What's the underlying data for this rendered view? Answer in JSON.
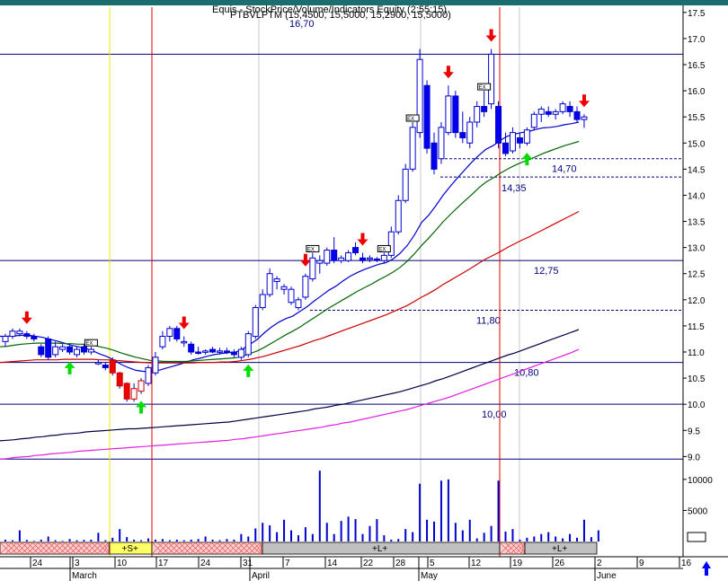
{
  "header": {
    "title_line1": "Equis - StockPrice/Volume/Indicators Equity (2:55:15)",
    "title_line2": "PTBVLPTM (15,4500, 15,5000, 15,2900, 15,5000)",
    "top_level_label": "16,70"
  },
  "colors": {
    "background": "#ffffff",
    "up_candle": "#ffffff",
    "down_candle": "#0000ee",
    "candle_outline": "#0000cc",
    "ma_short": "#0000cc",
    "ma_mid": "#006600",
    "ma_long": "#cc0000",
    "ma_200": "#000044",
    "ma_magenta": "#e020e0",
    "hline": "#00007a",
    "vline_red": "#dd0000",
    "vline_yellow": "#e8e800",
    "sell_arrow": "#ee0000",
    "buy_arrow": "#00dd00",
    "volume": "#0000cc",
    "band_pink": "#ffd0d0",
    "band_yellow": "#ffff66",
    "band_gray": "#c0c0c0",
    "corner_arrow": "#0000ff"
  },
  "chart_data": {
    "type": "candlestick",
    "title": "",
    "price_axis": {
      "ylim": [
        8.8,
        17.6
      ],
      "ticks": [
        "17.5",
        "17.0",
        "16.5",
        "16.0",
        "15.5",
        "15.0",
        "14.5",
        "14.0",
        "13.5",
        "13.0",
        "12.5",
        "12.0",
        "11.5",
        "11.0",
        "10.5",
        "10.0",
        "9.5",
        "9.0"
      ]
    },
    "volume_axis": {
      "ylim": [
        0,
        12000
      ],
      "ticks": [
        "10000",
        "5000"
      ]
    },
    "x_axis": {
      "day_ticks": [
        "24",
        "3",
        "10",
        "17",
        "24",
        "31",
        "7",
        "14",
        "22",
        "28",
        "5",
        "12",
        "19",
        "26",
        "2",
        "9",
        "16"
      ],
      "month_labels": [
        "March",
        "April",
        "May",
        "June"
      ]
    },
    "horizontal_levels": [
      {
        "value": 16.7,
        "label": "16,70",
        "style": "solid"
      },
      {
        "value": 14.7,
        "label": "14,70",
        "style": "dashed"
      },
      {
        "value": 14.35,
        "label": "14,35",
        "style": "dashed"
      },
      {
        "value": 12.75,
        "label": "12,75",
        "style": "solid"
      },
      {
        "value": 11.8,
        "label": "11,80",
        "style": "dashed"
      },
      {
        "value": 10.8,
        "label": "10,80",
        "style": "solid"
      },
      {
        "value": 10.0,
        "label": "10,00",
        "style": "solid"
      },
      {
        "value": 8.95,
        "label": "",
        "style": "solid"
      }
    ],
    "signal_bands": [
      {
        "label": "",
        "kind": "pink"
      },
      {
        "label": "+S+",
        "kind": "yellow"
      },
      {
        "label": "",
        "kind": "pink"
      },
      {
        "label": "+L+",
        "kind": "gray"
      },
      {
        "label": "",
        "kind": "pink"
      },
      {
        "label": "+L+",
        "kind": "gray"
      }
    ],
    "candles": [
      {
        "o": 11.2,
        "h": 11.35,
        "l": 11.1,
        "c": 11.3
      },
      {
        "o": 11.3,
        "h": 11.45,
        "l": 11.25,
        "c": 11.4
      },
      {
        "o": 11.35,
        "h": 11.45,
        "l": 11.3,
        "c": 11.4
      },
      {
        "o": 11.35,
        "h": 11.4,
        "l": 11.25,
        "c": 11.3
      },
      {
        "o": 11.3,
        "h": 11.35,
        "l": 11.2,
        "c": 11.25
      },
      {
        "o": 11.1,
        "h": 11.15,
        "l": 10.9,
        "c": 10.95
      },
      {
        "o": 11.25,
        "h": 11.3,
        "l": 10.85,
        "c": 10.9
      },
      {
        "o": 10.95,
        "h": 11.2,
        "l": 10.9,
        "c": 11.1
      },
      {
        "o": 11.05,
        "h": 11.15,
        "l": 11.0,
        "c": 11.1
      },
      {
        "o": 11.1,
        "h": 11.15,
        "l": 10.95,
        "c": 11.0
      },
      {
        "o": 10.95,
        "h": 11.1,
        "l": 10.9,
        "c": 11.05
      },
      {
        "o": 11.1,
        "h": 11.15,
        "l": 10.95,
        "c": 11.0
      },
      {
        "o": 11.0,
        "h": 11.1,
        "l": 10.95,
        "c": 11.05
      },
      {
        "o": 10.8,
        "h": 10.85,
        "l": 10.75,
        "c": 10.8
      },
      {
        "o": 10.75,
        "h": 10.8,
        "l": 10.65,
        "c": 10.7
      },
      {
        "o": 10.85,
        "h": 10.9,
        "l": 10.55,
        "c": 10.6
      },
      {
        "o": 10.6,
        "h": 10.62,
        "l": 10.3,
        "c": 10.35
      },
      {
        "o": 10.4,
        "h": 10.42,
        "l": 10.05,
        "c": 10.1
      },
      {
        "o": 10.1,
        "h": 10.4,
        "l": 10.05,
        "c": 10.3
      },
      {
        "o": 10.25,
        "h": 10.5,
        "l": 10.2,
        "c": 10.45
      },
      {
        "o": 10.4,
        "h": 10.75,
        "l": 10.35,
        "c": 10.7
      },
      {
        "o": 10.6,
        "h": 11.0,
        "l": 10.55,
        "c": 10.9
      },
      {
        "o": 11.1,
        "h": 11.4,
        "l": 11.05,
        "c": 11.3
      },
      {
        "o": 11.3,
        "h": 11.5,
        "l": 11.2,
        "c": 11.45
      },
      {
        "o": 11.45,
        "h": 11.5,
        "l": 11.2,
        "c": 11.25
      },
      {
        "o": 11.2,
        "h": 11.3,
        "l": 11.1,
        "c": 11.2
      },
      {
        "o": 11.15,
        "h": 11.2,
        "l": 10.95,
        "c": 11.0
      },
      {
        "o": 11.0,
        "h": 11.1,
        "l": 10.95,
        "c": 10.98
      },
      {
        "o": 11.0,
        "h": 11.05,
        "l": 10.95,
        "c": 11.02
      },
      {
        "o": 11.05,
        "h": 11.1,
        "l": 10.98,
        "c": 11.0
      },
      {
        "o": 11.0,
        "h": 11.08,
        "l": 10.95,
        "c": 11.02
      },
      {
        "o": 11.02,
        "h": 11.08,
        "l": 10.96,
        "c": 10.99
      },
      {
        "o": 11.0,
        "h": 11.05,
        "l": 10.9,
        "c": 10.95
      },
      {
        "o": 10.9,
        "h": 11.1,
        "l": 10.85,
        "c": 11.05
      },
      {
        "o": 10.95,
        "h": 11.4,
        "l": 10.9,
        "c": 11.35
      },
      {
        "o": 11.3,
        "h": 11.9,
        "l": 11.25,
        "c": 11.85
      },
      {
        "o": 11.85,
        "h": 12.2,
        "l": 11.8,
        "c": 12.1
      },
      {
        "o": 12.1,
        "h": 12.6,
        "l": 12.05,
        "c": 12.5
      },
      {
        "o": 12.35,
        "h": 12.45,
        "l": 12.2,
        "c": 12.4
      },
      {
        "o": 12.2,
        "h": 12.3,
        "l": 12.1,
        "c": 12.25
      },
      {
        "o": 11.95,
        "h": 12.25,
        "l": 11.9,
        "c": 12.2
      },
      {
        "o": 11.85,
        "h": 12.05,
        "l": 11.8,
        "c": 12.0
      },
      {
        "o": 12.05,
        "h": 12.5,
        "l": 12.0,
        "c": 12.45
      },
      {
        "o": 12.4,
        "h": 12.9,
        "l": 12.35,
        "c": 12.8
      },
      {
        "o": 12.7,
        "h": 12.85,
        "l": 12.5,
        "c": 12.75
      },
      {
        "o": 12.7,
        "h": 13.0,
        "l": 12.65,
        "c": 12.95
      },
      {
        "o": 12.95,
        "h": 13.2,
        "l": 12.7,
        "c": 12.75
      },
      {
        "o": 12.75,
        "h": 12.85,
        "l": 12.7,
        "c": 12.8
      },
      {
        "o": 12.75,
        "h": 12.95,
        "l": 12.72,
        "c": 12.9
      },
      {
        "o": 13.0,
        "h": 13.1,
        "l": 12.85,
        "c": 12.9
      },
      {
        "o": 12.8,
        "h": 12.9,
        "l": 12.7,
        "c": 12.75
      },
      {
        "o": 12.78,
        "h": 12.85,
        "l": 12.72,
        "c": 12.8
      },
      {
        "o": 12.78,
        "h": 12.82,
        "l": 12.72,
        "c": 12.76
      },
      {
        "o": 12.75,
        "h": 12.9,
        "l": 12.7,
        "c": 12.85
      },
      {
        "o": 12.85,
        "h": 13.4,
        "l": 12.8,
        "c": 13.3
      },
      {
        "o": 13.3,
        "h": 14.0,
        "l": 13.25,
        "c": 13.9
      },
      {
        "o": 13.9,
        "h": 14.6,
        "l": 13.85,
        "c": 14.5
      },
      {
        "o": 14.5,
        "h": 15.4,
        "l": 14.45,
        "c": 15.3
      },
      {
        "o": 15.2,
        "h": 16.8,
        "l": 15.1,
        "c": 16.6
      },
      {
        "o": 16.1,
        "h": 16.2,
        "l": 14.8,
        "c": 14.9
      },
      {
        "o": 15.0,
        "h": 15.2,
        "l": 14.4,
        "c": 14.5
      },
      {
        "o": 14.7,
        "h": 15.4,
        "l": 14.6,
        "c": 15.3
      },
      {
        "o": 15.2,
        "h": 16.1,
        "l": 15.15,
        "c": 15.9
      },
      {
        "o": 15.9,
        "h": 16.0,
        "l": 15.1,
        "c": 15.2
      },
      {
        "o": 15.2,
        "h": 15.6,
        "l": 15.0,
        "c": 15.1
      },
      {
        "o": 15.0,
        "h": 15.5,
        "l": 14.9,
        "c": 15.4
      },
      {
        "o": 15.4,
        "h": 15.8,
        "l": 15.3,
        "c": 15.7
      },
      {
        "o": 15.7,
        "h": 16.0,
        "l": 15.5,
        "c": 15.6
      },
      {
        "o": 15.75,
        "h": 16.8,
        "l": 15.65,
        "c": 16.7
      },
      {
        "o": 15.7,
        "h": 15.8,
        "l": 14.9,
        "c": 15.0
      },
      {
        "o": 15.0,
        "h": 15.2,
        "l": 14.75,
        "c": 14.8
      },
      {
        "o": 14.85,
        "h": 15.3,
        "l": 14.8,
        "c": 15.2
      },
      {
        "o": 15.1,
        "h": 15.2,
        "l": 14.9,
        "c": 15.0
      },
      {
        "o": 15.0,
        "h": 15.3,
        "l": 14.95,
        "c": 15.25
      },
      {
        "o": 15.3,
        "h": 15.6,
        "l": 15.25,
        "c": 15.55
      },
      {
        "o": 15.55,
        "h": 15.7,
        "l": 15.4,
        "c": 15.65
      },
      {
        "o": 15.6,
        "h": 15.7,
        "l": 15.5,
        "c": 15.55
      },
      {
        "o": 15.55,
        "h": 15.65,
        "l": 15.45,
        "c": 15.6
      },
      {
        "o": 15.6,
        "h": 15.8,
        "l": 15.55,
        "c": 15.75
      },
      {
        "o": 15.7,
        "h": 15.8,
        "l": 15.5,
        "c": 15.6
      },
      {
        "o": 15.6,
        "h": 15.7,
        "l": 15.4,
        "c": 15.45
      },
      {
        "o": 15.45,
        "h": 15.55,
        "l": 15.29,
        "c": 15.5
      }
    ],
    "volume": [
      300,
      200,
      1800,
      250,
      100,
      300,
      800,
      200,
      100,
      400,
      200,
      250,
      300,
      1400,
      200,
      600,
      2000,
      700,
      300,
      200,
      500,
      300,
      400,
      200,
      300,
      200,
      300,
      400,
      800,
      300,
      200,
      400,
      300,
      1200,
      800,
      2100,
      3000,
      2600,
      1500,
      3500,
      1800,
      1000,
      2300,
      1200,
      11400,
      3000,
      1200,
      3300,
      4000,
      3600,
      1200,
      2500,
      3600,
      1000,
      300,
      400,
      2000,
      1500,
      9300,
      3500,
      3200,
      9800,
      10000,
      3000,
      1800,
      3500,
      500,
      1400,
      2500,
      9800,
      1600,
      2000,
      300,
      600,
      800,
      1200,
      1500,
      800,
      500,
      1200,
      600,
      3500,
      700,
      1800
    ],
    "moving_averages": [
      {
        "values": [
          11.3,
          11.3,
          11.31,
          11.32,
          11.32,
          11.3,
          11.28,
          11.24,
          11.21,
          11.17,
          11.13,
          11.1,
          11.07,
          11.02,
          10.96,
          10.91,
          10.84,
          10.76,
          10.7,
          10.65,
          10.63,
          10.62,
          10.64,
          10.68,
          10.72,
          10.76,
          10.8,
          10.85,
          10.88,
          10.92,
          10.95,
          10.97,
          10.99,
          11.0,
          11.06,
          11.15,
          11.24,
          11.37,
          11.48,
          11.57,
          11.64,
          11.69,
          11.78,
          11.87,
          11.98,
          12.08,
          12.18,
          12.26,
          12.36,
          12.45,
          12.52,
          12.58,
          12.63,
          12.68,
          12.71,
          12.78,
          12.89,
          13.04,
          13.24,
          13.48,
          13.62,
          13.8,
          14.0,
          14.17,
          14.33,
          14.48,
          14.63,
          14.76,
          14.88,
          14.95,
          15.05,
          15.13,
          15.17,
          15.2,
          15.22,
          15.26,
          15.29,
          15.3,
          15.32,
          15.35,
          15.37,
          15.4
        ]
      },
      {
        "values": [
          11.1,
          11.11,
          11.13,
          11.15,
          11.16,
          11.17,
          11.17,
          11.17,
          11.17,
          11.16,
          11.16,
          11.15,
          11.15,
          11.13,
          11.1,
          11.07,
          11.03,
          10.98,
          10.94,
          10.9,
          10.87,
          10.84,
          10.83,
          10.82,
          10.82,
          10.82,
          10.82,
          10.83,
          10.84,
          10.85,
          10.86,
          10.87,
          10.88,
          10.89,
          10.92,
          10.97,
          11.02,
          11.09,
          11.17,
          11.25,
          11.33,
          11.4,
          11.48,
          11.57,
          11.66,
          11.75,
          11.84,
          11.92,
          12.0,
          12.08,
          12.16,
          12.23,
          12.3,
          12.38,
          12.45,
          12.53,
          12.62,
          12.74,
          12.88,
          13.04,
          13.18,
          13.33,
          13.49,
          13.63,
          13.76,
          13.89,
          14.01,
          14.14,
          14.25,
          14.33,
          14.42,
          14.5,
          14.57,
          14.63,
          14.68,
          14.74,
          14.8,
          14.85,
          14.9,
          14.95,
          14.99,
          15.03
        ]
      },
      {
        "values": [
          10.8,
          10.81,
          10.82,
          10.83,
          10.84,
          10.85,
          10.85,
          10.85,
          10.85,
          10.86,
          10.86,
          10.86,
          10.86,
          10.86,
          10.85,
          10.85,
          10.84,
          10.83,
          10.82,
          10.81,
          10.8,
          10.79,
          10.79,
          10.79,
          10.79,
          10.79,
          10.79,
          10.79,
          10.8,
          10.8,
          10.8,
          10.81,
          10.81,
          10.82,
          10.84,
          10.86,
          10.89,
          10.92,
          10.96,
          11.0,
          11.04,
          11.08,
          11.12,
          11.17,
          11.22,
          11.26,
          11.31,
          11.36,
          11.41,
          11.46,
          11.51,
          11.56,
          11.61,
          11.66,
          11.71,
          11.77,
          11.83,
          11.89,
          11.97,
          12.05,
          12.12,
          12.2,
          12.29,
          12.37,
          12.45,
          12.53,
          12.61,
          12.7,
          12.78,
          12.85,
          12.92,
          13.0,
          13.07,
          13.14,
          13.2,
          13.27,
          13.34,
          13.41,
          13.48,
          13.55,
          13.62,
          13.69
        ]
      },
      {
        "values": [
          9.3,
          9.31,
          9.32,
          9.34,
          9.35,
          9.37,
          9.38,
          9.4,
          9.41,
          9.43,
          9.44,
          9.45,
          9.47,
          9.48,
          9.49,
          9.5,
          9.51,
          9.52,
          9.53,
          9.53,
          9.54,
          9.55,
          9.56,
          9.57,
          9.58,
          9.59,
          9.6,
          9.61,
          9.62,
          9.63,
          9.64,
          9.65,
          9.66,
          9.68,
          9.7,
          9.72,
          9.74,
          9.76,
          9.78,
          9.8,
          9.82,
          9.84,
          9.86,
          9.88,
          9.91,
          9.93,
          9.95,
          9.98,
          10.0,
          10.03,
          10.06,
          10.09,
          10.12,
          10.15,
          10.18,
          10.21,
          10.24,
          10.28,
          10.32,
          10.36,
          10.4,
          10.45,
          10.49,
          10.54,
          10.59,
          10.64,
          10.69,
          10.74,
          10.79,
          10.84,
          10.89,
          10.94,
          10.98,
          11.03,
          11.08,
          11.13,
          11.18,
          11.23,
          11.28,
          11.33,
          11.38,
          11.43
        ]
      },
      {
        "values": [
          8.95,
          8.96,
          8.98,
          8.99,
          9.0,
          9.02,
          9.03,
          9.05,
          9.06,
          9.07,
          9.08,
          9.1,
          9.11,
          9.12,
          9.13,
          9.14,
          9.15,
          9.16,
          9.17,
          9.18,
          9.19,
          9.2,
          9.21,
          9.22,
          9.23,
          9.24,
          9.25,
          9.26,
          9.27,
          9.28,
          9.29,
          9.3,
          9.31,
          9.33,
          9.34,
          9.36,
          9.38,
          9.4,
          9.42,
          9.44,
          9.46,
          9.48,
          9.5,
          9.52,
          9.54,
          9.56,
          9.59,
          9.61,
          9.64,
          9.66,
          9.69,
          9.72,
          9.75,
          9.78,
          9.81,
          9.84,
          9.87,
          9.9,
          9.94,
          9.98,
          10.02,
          10.06,
          10.1,
          10.14,
          10.19,
          10.24,
          10.29,
          10.34,
          10.39,
          10.44,
          10.49,
          10.54,
          10.59,
          10.64,
          10.69,
          10.74,
          10.79,
          10.84,
          10.89,
          10.94,
          10.99,
          11.05
        ]
      }
    ],
    "signals": [
      {
        "kind": "sell",
        "index": 3
      },
      {
        "kind": "buy",
        "index": 9
      },
      {
        "kind": "buy",
        "index": 19
      },
      {
        "kind": "sell",
        "index": 25
      },
      {
        "kind": "buy",
        "index": 34
      },
      {
        "kind": "sell",
        "index": 42
      },
      {
        "kind": "sell",
        "index": 50
      },
      {
        "kind": "sell",
        "index": 62
      },
      {
        "kind": "sell",
        "index": 68
      },
      {
        "kind": "buy",
        "index": 73
      },
      {
        "kind": "sell",
        "index": 81
      }
    ],
    "markers": [
      {
        "label": "EX",
        "index": 12
      },
      {
        "label": "EX",
        "index": 43
      },
      {
        "label": "EX",
        "index": 53
      },
      {
        "label": "EX",
        "index": 57
      },
      {
        "label": "EX",
        "index": 67
      }
    ]
  }
}
